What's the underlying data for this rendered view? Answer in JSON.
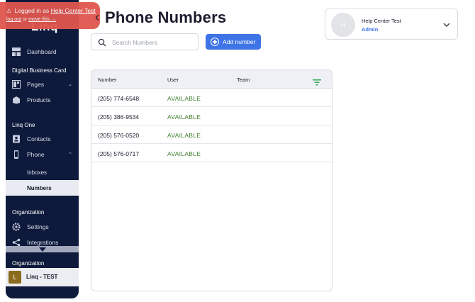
{
  "banner": {
    "prefix": "Logged in as",
    "user_link": "Help Center Test",
    "logout_link": "log out",
    "or_text": "or",
    "move_link": "move this →"
  },
  "sidebar": {
    "logo": "Linq",
    "dashboard_label": "Dashboard",
    "section_dbc": "Digital Business Card",
    "pages_label": "Pages",
    "products_label": "Products",
    "section_linq_one": "Linq One",
    "contacts_label": "Contacts",
    "phone_label": "Phone",
    "inboxes_label": "Inboxes",
    "numbers_label": "Numbers",
    "section_organization": "Organization",
    "settings_label": "Settings",
    "integrations_label": "Integrations",
    "org_bottom_label": "Organization",
    "account_initial": "L",
    "account_name": "Linq - TEST"
  },
  "header": {
    "title": "Phone Numbers",
    "back_icon": "chevron-left-icon"
  },
  "search": {
    "placeholder": "Search Numbers",
    "value": ""
  },
  "add_button": {
    "label": "Add number"
  },
  "user_card": {
    "initial": "H",
    "name": "Help Center Test",
    "role": "Admin"
  },
  "table": {
    "columns": [
      "Number",
      "User",
      "Team"
    ],
    "rows": [
      {
        "number": "(205) 774-6548",
        "user": "AVAILABLE",
        "team": ""
      },
      {
        "number": "(205) 386-9534",
        "user": "AVAILABLE",
        "team": ""
      },
      {
        "number": "(205) 576-0520",
        "user": "AVAILABLE",
        "team": ""
      },
      {
        "number": "(205) 576-0717",
        "user": "AVAILABLE",
        "team": ""
      }
    ]
  },
  "colors": {
    "sidebar_bg": "#0e1a3b",
    "banner_bg": "#e0564e",
    "accent_blue": "#3e74e6",
    "available_green": "#3f7d2f",
    "table_header_bg": "#eef0f6",
    "filter_green": "#2fa84f"
  }
}
